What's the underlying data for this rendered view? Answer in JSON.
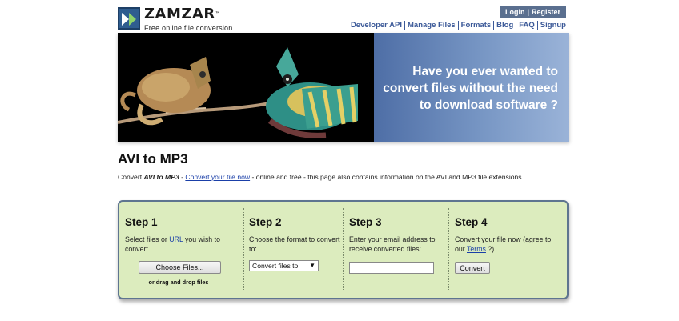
{
  "brand": {
    "name": "ZAMZAR",
    "trademark": "™",
    "tagline": "Free online file conversion",
    "logo_color": "#2f5d8f"
  },
  "auth": {
    "login_label": "Login",
    "separator": "|",
    "register_label": "Register"
  },
  "nav": {
    "items": [
      {
        "label": "Developer API"
      },
      {
        "label": "Manage Files"
      },
      {
        "label": "Formats"
      },
      {
        "label": "Blog"
      },
      {
        "label": "FAQ"
      },
      {
        "label": "Signup"
      }
    ]
  },
  "banner": {
    "lines": [
      "Have you ever wanted to",
      "convert files without the need",
      "to download software ?"
    ]
  },
  "page": {
    "title": "AVI to MP3",
    "subtitle_prefix": "Convert ",
    "subtitle_bold": "AVI to MP3",
    "subtitle_dash": " - ",
    "subtitle_link": "Convert your file now",
    "subtitle_suffix": " - online and free - this page also contains information on the AVI and MP3 file extensions."
  },
  "steps": {
    "step1": {
      "title": "Step 1",
      "text_before": "Select files or ",
      "link": "URL",
      "text_after": " you wish to convert ...",
      "button": "Choose Files...",
      "drag_note": "or drag and drop files"
    },
    "step2": {
      "title": "Step 2",
      "text": "Choose the format to convert to:",
      "select_value": "Convert files to:"
    },
    "step3": {
      "title": "Step 3",
      "text": "Enter your email address to receive converted files:",
      "email_value": ""
    },
    "step4": {
      "title": "Step 4",
      "text_before": "Convert your file now (agree to our ",
      "link": "Terms",
      "text_after": " ?)",
      "button": "Convert"
    }
  }
}
